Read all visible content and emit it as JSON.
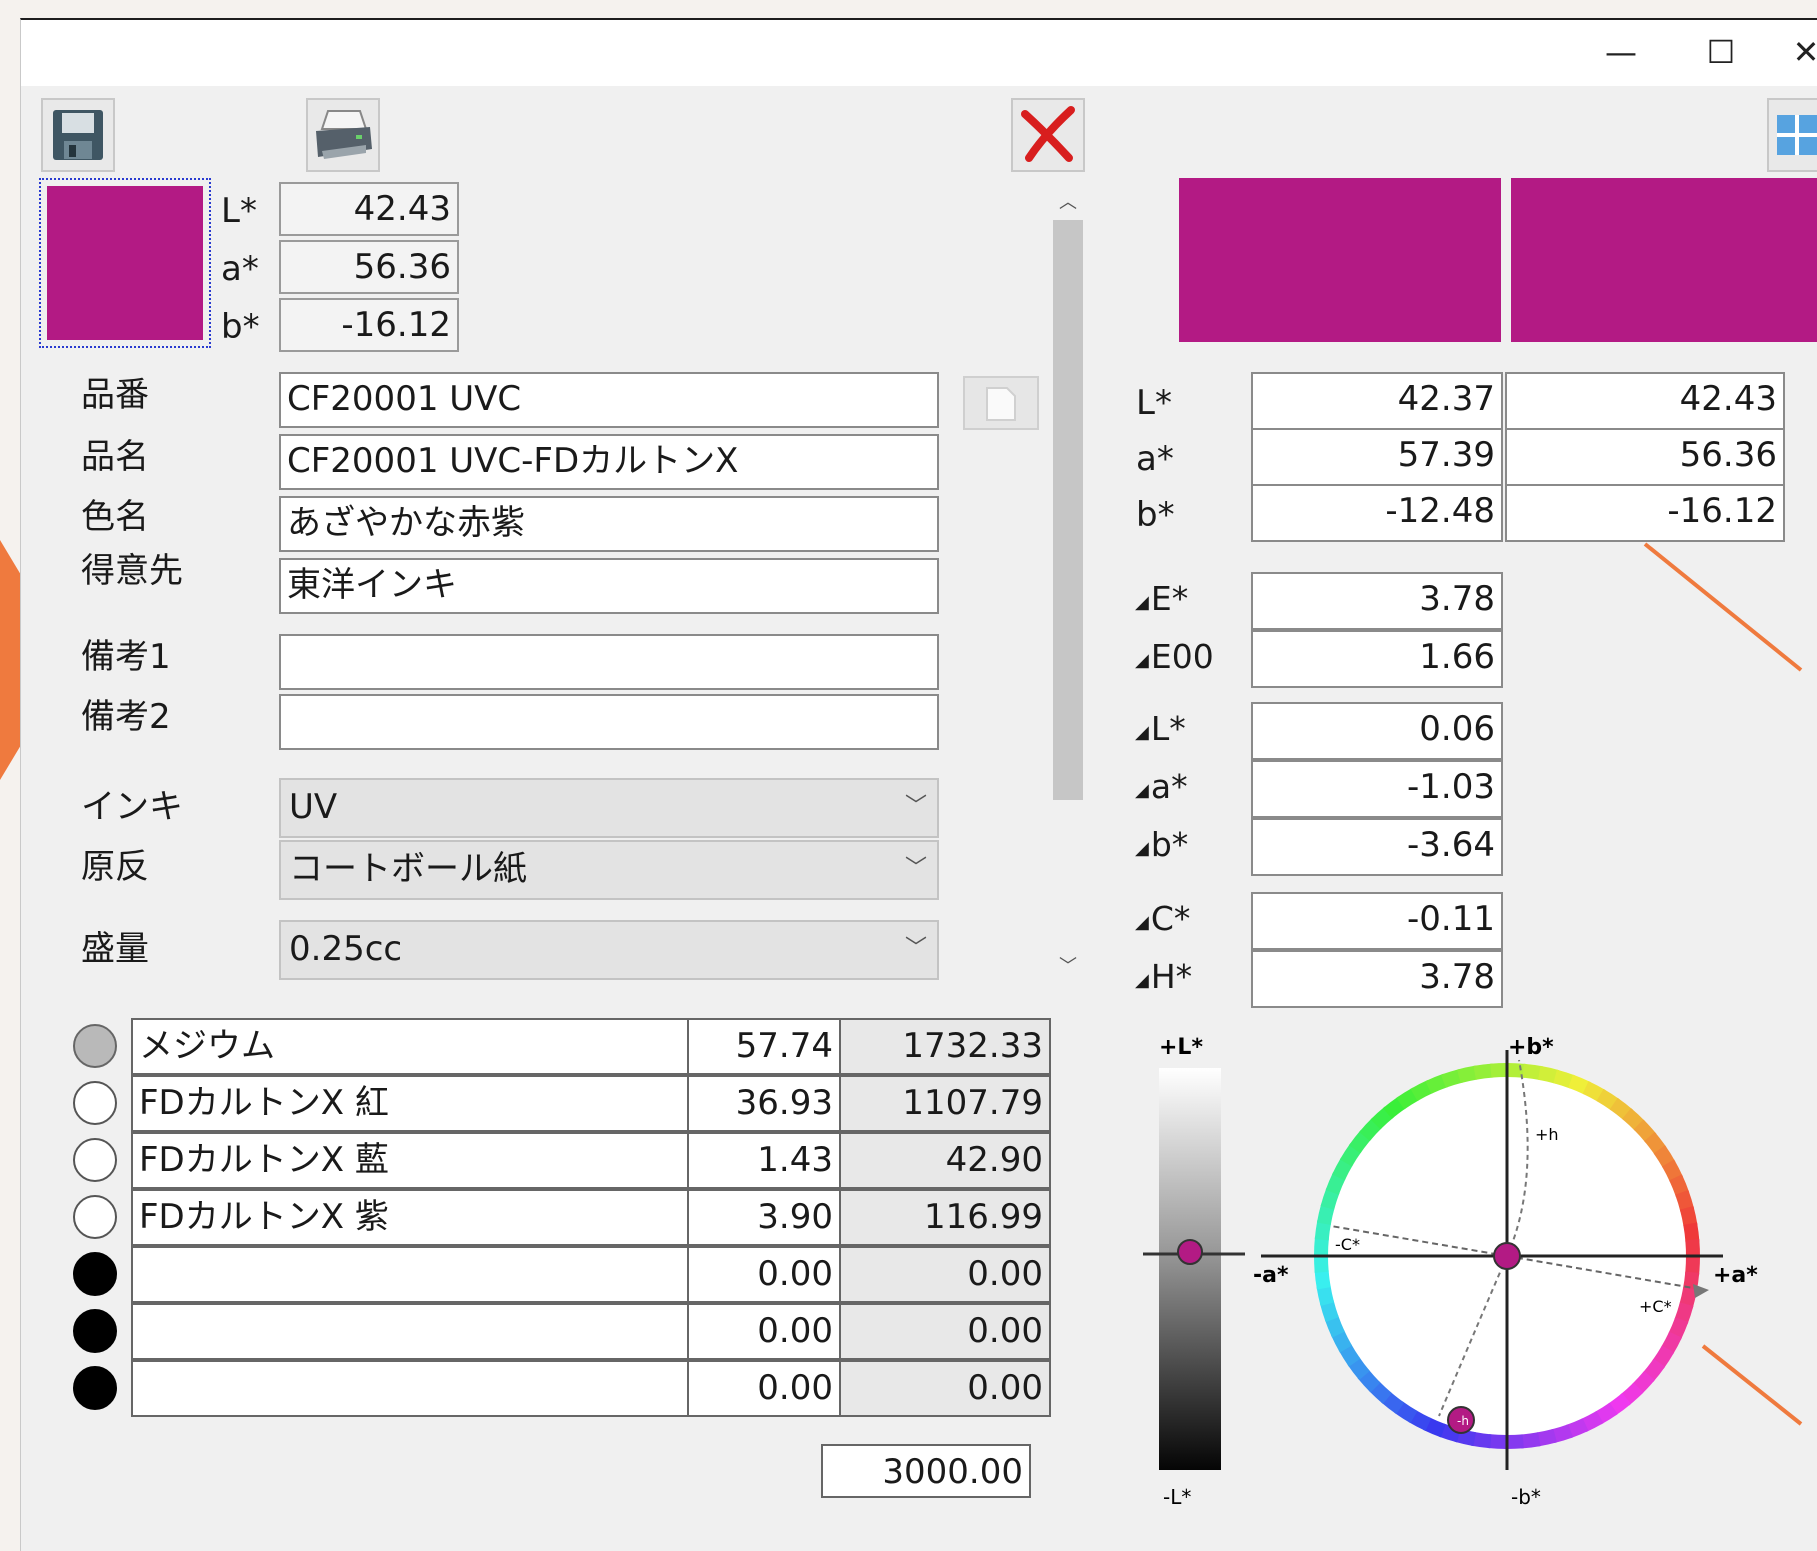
{
  "window": {
    "controls": {
      "minimize": "—",
      "maximize": "☐",
      "close": "✕"
    },
    "toolbar": {
      "save_icon": "floppy-disk-icon",
      "print_icon": "printer-icon",
      "delete_icon": "red-x-icon",
      "layout_icon": "grid-layout-icon"
    }
  },
  "colors": {
    "swatch": "#b31a84",
    "accent_arrow": "#ef7a3e"
  },
  "measured": {
    "labels": [
      "L*",
      "a*",
      "b*"
    ],
    "values": [
      "42.43",
      "56.36",
      "-16.12"
    ]
  },
  "form": {
    "fields": [
      {
        "label": "品番",
        "value": "CF20001 UVC"
      },
      {
        "label": "品名",
        "value": "CF20001 UVC-FDカルトンX"
      },
      {
        "label": "色名",
        "value": "あざやかな赤紫"
      },
      {
        "label": "得意先",
        "value": "東洋インキ"
      },
      {
        "label": "備考1",
        "value": ""
      },
      {
        "label": "備考2",
        "value": ""
      }
    ],
    "combos": [
      {
        "label": "インキ",
        "value": "UV"
      },
      {
        "label": "原反",
        "value": "コートボール紙"
      },
      {
        "label": "盛量",
        "value": "0.25cc"
      }
    ]
  },
  "recipe": {
    "rows": [
      {
        "name": "メジウム",
        "percent": "57.74",
        "amount": "1732.33",
        "radio": "gray"
      },
      {
        "name": "FDカルトンX 紅",
        "percent": "36.93",
        "amount": "1107.79",
        "radio": "empty"
      },
      {
        "name": "FDカルトンX 藍",
        "percent": "1.43",
        "amount": "42.90",
        "radio": "empty"
      },
      {
        "name": "FDカルトンX 紫",
        "percent": "3.90",
        "amount": "116.99",
        "radio": "empty"
      },
      {
        "name": "",
        "percent": "0.00",
        "amount": "0.00",
        "radio": "filled"
      },
      {
        "name": "",
        "percent": "0.00",
        "amount": "0.00",
        "radio": "filled"
      },
      {
        "name": "",
        "percent": "0.00",
        "amount": "0.00",
        "radio": "filled"
      }
    ],
    "total": "3000.00"
  },
  "compare": {
    "lab_labels": [
      "L*",
      "a*",
      "b*"
    ],
    "target": [
      "42.37",
      "57.39",
      "-12.48"
    ],
    "sample": [
      "42.43",
      "56.36",
      "-16.12"
    ],
    "delta": [
      {
        "label": "E*",
        "value": "3.78"
      },
      {
        "label": "E00",
        "value": "1.66"
      },
      {
        "label": "L*",
        "value": "0.06"
      },
      {
        "label": "a*",
        "value": "-1.03"
      },
      {
        "label": "b*",
        "value": "-3.64"
      },
      {
        "label": "C*",
        "value": "-0.11"
      },
      {
        "label": "H*",
        "value": "3.78"
      }
    ],
    "delta_symbol": "◢"
  },
  "diagram": {
    "l_axis": {
      "top": "+L*",
      "bottom": "-L*"
    },
    "ab_axis": {
      "top": "+b*",
      "bottom": "-b*",
      "left": "-a*",
      "right": "+a*"
    },
    "annotations": {
      "plus_h": "+h",
      "minus_h": "-h",
      "minus_c": "-C*",
      "plus_c": "+C*"
    }
  }
}
